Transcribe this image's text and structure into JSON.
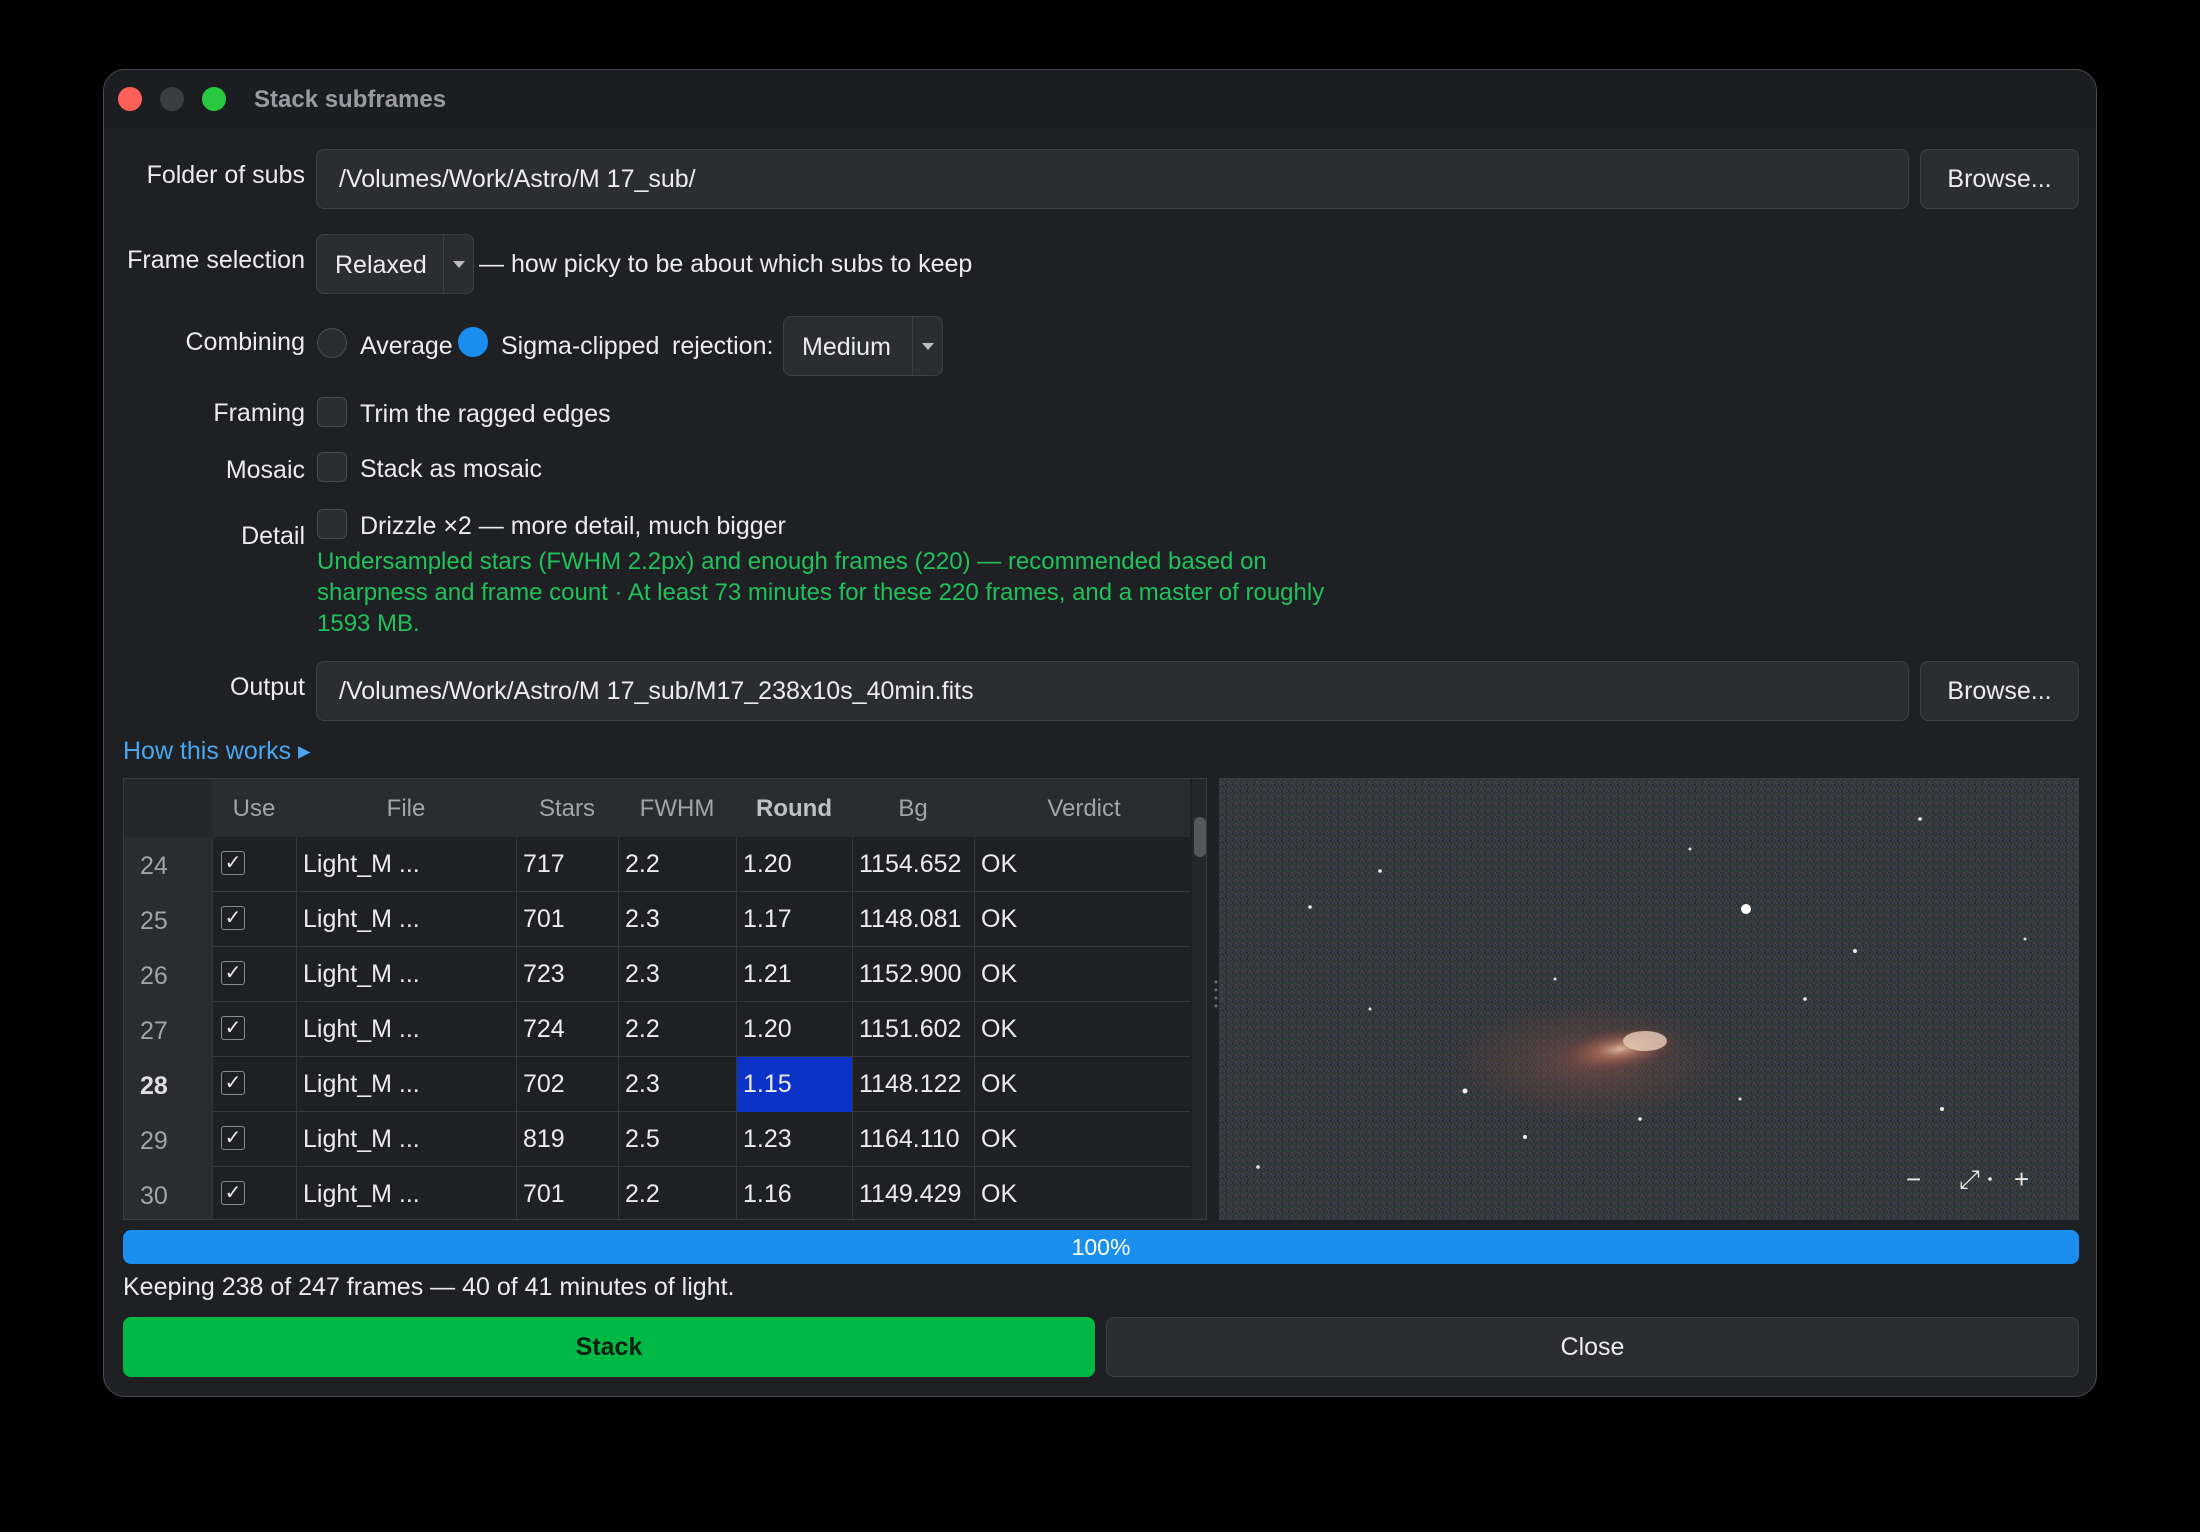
{
  "window": {
    "title": "Stack subframes"
  },
  "folder": {
    "label": "Folder of subs",
    "value": "/Volumes/Work/Astro/M 17_sub/",
    "browse": "Browse..."
  },
  "frame_selection": {
    "label": "Frame selection",
    "value": "Relaxed",
    "hint": "— how picky to be about which subs to keep"
  },
  "combining": {
    "label": "Combining",
    "option_average": "Average",
    "option_sigma": "Sigma-clipped",
    "selected": "Sigma-clipped",
    "rejection_label": "rejection:",
    "rejection_value": "Medium"
  },
  "framing": {
    "label": "Framing",
    "checkbox": "Trim the ragged edges",
    "checked": false
  },
  "mosaic": {
    "label": "Mosaic",
    "checkbox": "Stack as mosaic",
    "checked": false
  },
  "detail": {
    "label": "Detail",
    "checkbox": "Drizzle ×2 — more detail, much bigger",
    "checked": false,
    "hint": "Undersampled stars (FWHM 2.2px) and enough frames (220) — recommended based on sharpness and frame count  ·  At least 73 minutes for these 220 frames, and a master of roughly 1593 MB."
  },
  "output": {
    "label": "Output",
    "value": "/Volumes/Work/Astro/M 17_sub/M17_238x10s_40min.fits",
    "browse": "Browse..."
  },
  "how_link": "How this works ▸",
  "table": {
    "columns": [
      "Use",
      "File",
      "Stars",
      "FWHM",
      "Round",
      "Bg",
      "Verdict"
    ],
    "sorted_column": "Round",
    "current_row": "28",
    "rows": [
      {
        "n": "24",
        "use": "✓",
        "file": "Light_M ...",
        "stars": "717",
        "fwhm": "2.2",
        "round": "1.20",
        "bg": "1154.652",
        "verdict": "OK"
      },
      {
        "n": "25",
        "use": "✓",
        "file": "Light_M ...",
        "stars": "701",
        "fwhm": "2.3",
        "round": "1.17",
        "bg": "1148.081",
        "verdict": "OK"
      },
      {
        "n": "26",
        "use": "✓",
        "file": "Light_M ...",
        "stars": "723",
        "fwhm": "2.3",
        "round": "1.21",
        "bg": "1152.900",
        "verdict": "OK"
      },
      {
        "n": "27",
        "use": "✓",
        "file": "Light_M ...",
        "stars": "724",
        "fwhm": "2.2",
        "round": "1.20",
        "bg": "1151.602",
        "verdict": "OK"
      },
      {
        "n": "28",
        "use": "✓",
        "file": "Light_M ...",
        "stars": "702",
        "fwhm": "2.3",
        "round": "1.15",
        "bg": "1148.122",
        "verdict": "OK"
      },
      {
        "n": "29",
        "use": "✓",
        "file": "Light_M ...",
        "stars": "819",
        "fwhm": "2.5",
        "round": "1.23",
        "bg": "1164.110",
        "verdict": "OK"
      },
      {
        "n": "30",
        "use": "✓",
        "file": "Light_M ...",
        "stars": "701",
        "fwhm": "2.2",
        "round": "1.16",
        "bg": "1149.429",
        "verdict": "OK"
      }
    ]
  },
  "preview": {
    "zoom_out": "−",
    "fit": "⤢",
    "zoom_in": "+"
  },
  "progress": {
    "value": 100,
    "label": "100%"
  },
  "status": "Keeping 238 of 247 frames — 40 of 41 minutes of light.",
  "buttons": {
    "stack": "Stack",
    "close": "Close"
  },
  "colors": {
    "accent": "#1a8ff0",
    "stack_green": "#00b944",
    "hint_green": "#1fc25a",
    "selection": "#0b33c8"
  }
}
